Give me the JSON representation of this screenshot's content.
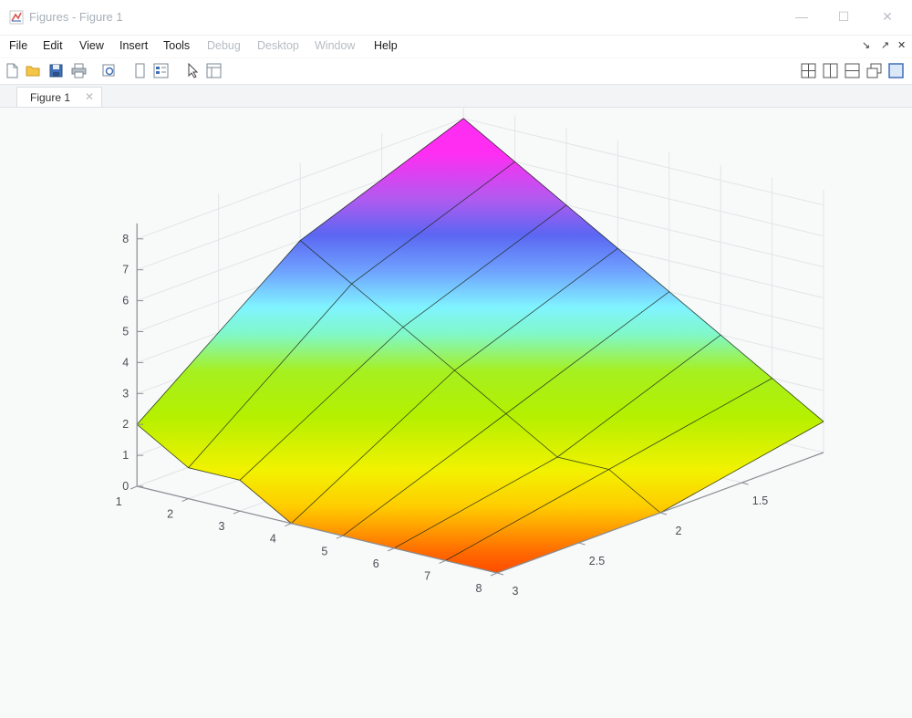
{
  "window": {
    "title": "Figures - Figure 1",
    "controls": {
      "minimize": "—",
      "maximize": "☐",
      "close": "✕"
    }
  },
  "menubar": {
    "items": [
      {
        "label": "File",
        "enabled": true
      },
      {
        "label": "Edit",
        "enabled": true
      },
      {
        "label": "View",
        "enabled": true
      },
      {
        "label": "Insert",
        "enabled": true
      },
      {
        "label": "Tools",
        "enabled": true
      },
      {
        "label": "Debug",
        "enabled": false
      },
      {
        "label": "Desktop",
        "enabled": false
      },
      {
        "label": "Window",
        "enabled": false
      },
      {
        "label": "Help",
        "enabled": true
      }
    ],
    "right_controls": [
      "↘",
      "↗",
      "✕"
    ]
  },
  "toolbar": {
    "left_icons": [
      "new-figure-icon",
      "open-file-icon",
      "save-icon",
      "print-icon",
      "print-preview-icon",
      "link-plot-icon",
      "insert-colorbar-icon",
      "edit-plot-arrow-icon",
      "property-inspector-icon"
    ],
    "right_icons": [
      "tile-grid-icon",
      "split-vertical-icon",
      "split-horizontal-icon",
      "float-window-icon",
      "maximize-panel-icon"
    ]
  },
  "tabs": [
    {
      "label": "Figure 1",
      "close": "✕"
    }
  ],
  "chart_data": {
    "type": "surface",
    "title": "",
    "xlabel": "",
    "ylabel": "",
    "zlabel": "",
    "colormap": "hsv",
    "x": [
      1,
      2,
      3,
      4,
      5,
      6,
      7,
      8
    ],
    "y": [
      1,
      2,
      3
    ],
    "z": [
      [
        8,
        7,
        6,
        5,
        4,
        3,
        2,
        1
      ],
      [
        6,
        5,
        4,
        3,
        2,
        1,
        1,
        0
      ],
      [
        2,
        1,
        1,
        0,
        0,
        0,
        0,
        0
      ]
    ],
    "x_ticks": [
      "1",
      "2",
      "3",
      "4",
      "5",
      "6",
      "7",
      "8"
    ],
    "y_ticks": [
      "1.5",
      "2",
      "2.5",
      "3"
    ],
    "z_ticks": [
      "0",
      "1",
      "2",
      "3",
      "4",
      "5",
      "6",
      "7",
      "8"
    ],
    "xlim": [
      1,
      8
    ],
    "ylim": [
      1,
      3
    ],
    "zlim": [
      0,
      8.5
    ],
    "grid": true
  }
}
